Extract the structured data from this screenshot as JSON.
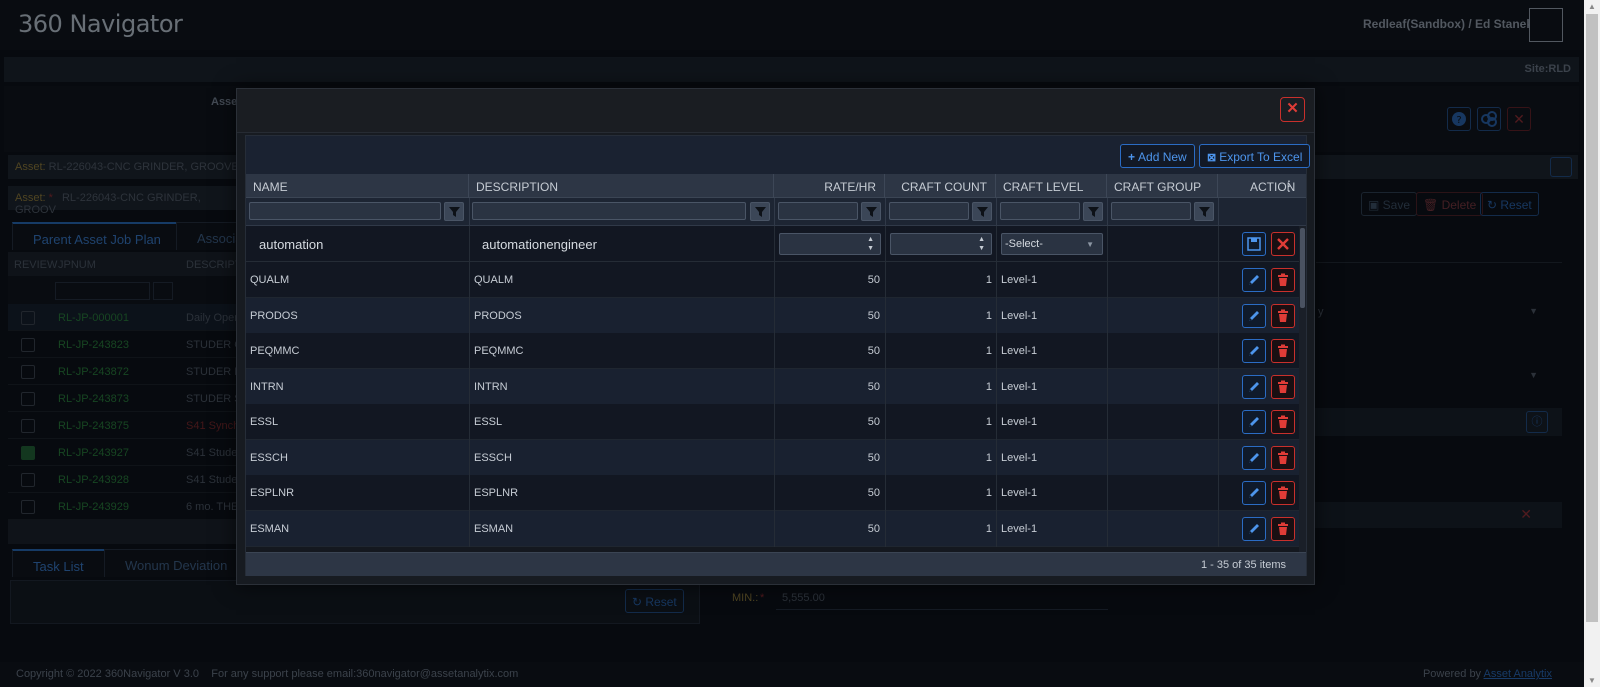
{
  "app": {
    "logo": "360 Navigator",
    "user": "Redleaf(Sandbox) / Ed Stanek",
    "site": "Site:RLD"
  },
  "background": {
    "asset_label": "Asset:",
    "asset_value": "RL-226043-CNC GRINDER, GROOVE",
    "asset2_label": "Asset:",
    "asset2_value": "RL-226043-CNC GRINDER, GROOV",
    "truncated_label": "Asse",
    "tabs": [
      "Parent Asset Job Plan",
      "Associa"
    ],
    "table_headers": [
      "REVIEW",
      "JPNUM",
      "DESCRIPT"
    ],
    "rows": [
      {
        "jp": "RL-JP-000001",
        "desc": "Daily Oper",
        "checked": false
      },
      {
        "jp": "RL-JP-243823",
        "desc": "STUDER G",
        "checked": false
      },
      {
        "jp": "RL-JP-243872",
        "desc": "STUDER P",
        "checked": false
      },
      {
        "jp": "RL-JP-243873",
        "desc": "STUDER S",
        "checked": false
      },
      {
        "jp": "RL-JP-243875",
        "desc": "S41 Synch",
        "checked": false
      },
      {
        "jp": "RL-JP-243927",
        "desc": "S41 Studer",
        "checked": true
      },
      {
        "jp": "RL-JP-243928",
        "desc": "S41 Studer",
        "checked": false
      },
      {
        "jp": "RL-JP-243929",
        "desc": "6 mo. THE",
        "checked": false
      }
    ],
    "bottom_tabs": [
      "Task List",
      "Wonum Deviation"
    ],
    "reset_label": "Reset",
    "save_label": "Save",
    "delete_label": "Delete",
    "reset2_label": "Reset",
    "min_label": "MIN.:",
    "min_value": "5,555.00"
  },
  "modal": {
    "toolbar": {
      "add_new": "Add New",
      "export": "Export To Excel"
    },
    "columns": [
      "NAME",
      "DESCRIPTION",
      "RATE/HR",
      "CRAFT COUNT",
      "CRAFT LEVEL",
      "CRAFT GROUP",
      "ACTION"
    ],
    "edit_row": {
      "name": "automation",
      "description": "automationengineer",
      "level_placeholder": "-Select-"
    },
    "rows": [
      {
        "name": "QUALM",
        "description": "QUALM",
        "rate": "50",
        "count": "1",
        "level": "Level-1",
        "group": ""
      },
      {
        "name": "PRODOS",
        "description": "PRODOS",
        "rate": "50",
        "count": "1",
        "level": "Level-1",
        "group": ""
      },
      {
        "name": "PEQMMC",
        "description": "PEQMMC",
        "rate": "50",
        "count": "1",
        "level": "Level-1",
        "group": ""
      },
      {
        "name": "INTRN",
        "description": "INTRN",
        "rate": "50",
        "count": "1",
        "level": "Level-1",
        "group": ""
      },
      {
        "name": "ESSL",
        "description": "ESSL",
        "rate": "50",
        "count": "1",
        "level": "Level-1",
        "group": ""
      },
      {
        "name": "ESSCH",
        "description": "ESSCH",
        "rate": "50",
        "count": "1",
        "level": "Level-1",
        "group": ""
      },
      {
        "name": "ESPLNR",
        "description": "ESPLNR",
        "rate": "50",
        "count": "1",
        "level": "Level-1",
        "group": ""
      },
      {
        "name": "ESMAN",
        "description": "ESMAN",
        "rate": "50",
        "count": "1",
        "level": "Level-1",
        "group": ""
      }
    ],
    "pager": "1 - 35 of 35 items"
  },
  "footer": {
    "copyright": "Copyright © 2022 360Navigator V 3.0",
    "support": "For any support please email:360navigator@assetanalytix.com",
    "powered": "Powered by",
    "powered_link": "Asset Analytix"
  }
}
